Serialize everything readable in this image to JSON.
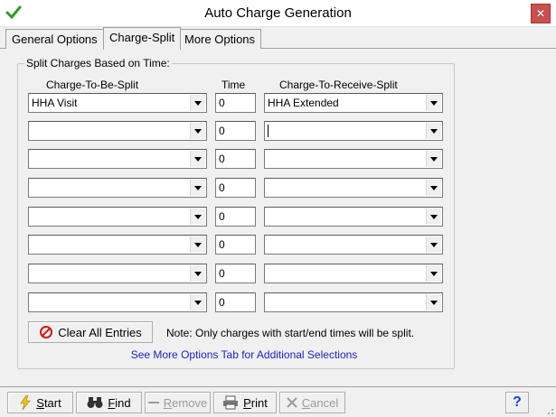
{
  "window": {
    "title": "Auto Charge Generation",
    "close_glyph": "✕"
  },
  "tabs": [
    {
      "label": "General Options"
    },
    {
      "label": "Charge-Split"
    },
    {
      "label": "More Options"
    }
  ],
  "group": {
    "label": "Split Charges Based on Time:",
    "col_charge": "Charge-To-Be-Split",
    "col_time": "Time",
    "col_receive": "Charge-To-Receive-Split"
  },
  "rows": [
    {
      "charge": "HHA Visit",
      "time": "0",
      "receive": "HHA Extended"
    },
    {
      "charge": "",
      "time": "0",
      "receive": ""
    },
    {
      "charge": "",
      "time": "0",
      "receive": ""
    },
    {
      "charge": "",
      "time": "0",
      "receive": ""
    },
    {
      "charge": "",
      "time": "0",
      "receive": ""
    },
    {
      "charge": "",
      "time": "0",
      "receive": ""
    },
    {
      "charge": "",
      "time": "0",
      "receive": ""
    },
    {
      "charge": "",
      "time": "0",
      "receive": ""
    }
  ],
  "clear_button": {
    "label": "Clear All Entries",
    "icon": "no-entry-icon"
  },
  "note": "Note: Only charges with start/end times will be split.",
  "link": "See More Options Tab for Additional Selections",
  "toolbar": {
    "start": {
      "label": "Start",
      "icon": "lightning-icon"
    },
    "find": {
      "label": "Find",
      "icon": "binoculars-icon"
    },
    "remove": {
      "label": "Remove",
      "icon": "minus-icon"
    },
    "print": {
      "label": "Print",
      "icon": "printer-icon"
    },
    "cancel": {
      "label": "Cancel",
      "icon": "cross-icon"
    },
    "help": {
      "label": "?",
      "icon": "help-icon"
    }
  },
  "colors": {
    "accent_link": "#1f1fb8",
    "close": "#c75050",
    "no_entry": "#d11a1a"
  }
}
